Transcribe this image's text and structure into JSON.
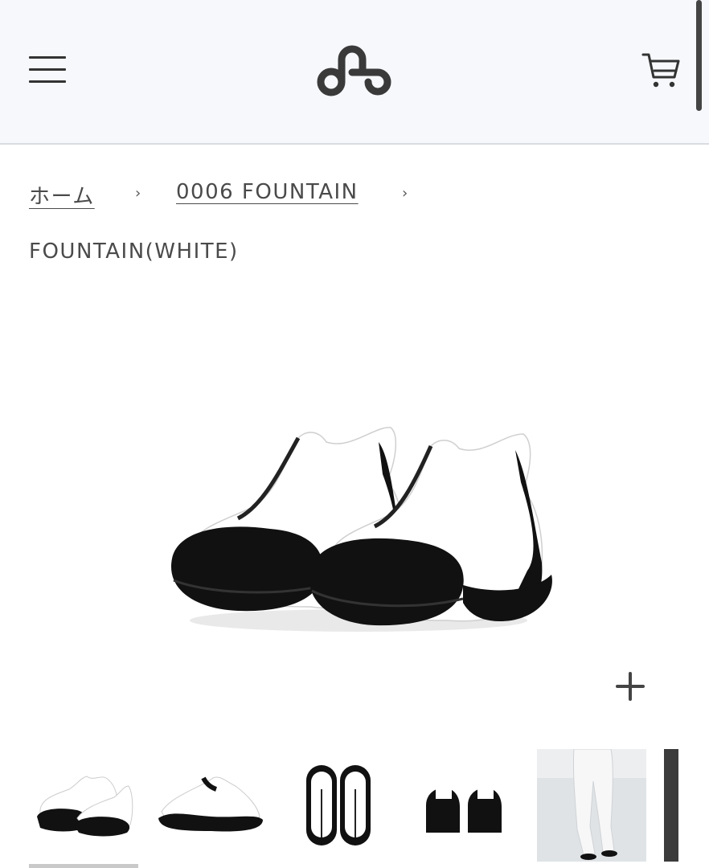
{
  "header": {
    "menu_icon": "hamburger-menu-icon",
    "logo_icon": "brand-logo",
    "cart_icon": "shopping-cart-icon"
  },
  "breadcrumb": {
    "home_label": "ホーム",
    "collection_label": "0006 FOUNTAIN",
    "separator": "›",
    "current": "FOUNTAIN(WHITE)"
  },
  "product": {
    "zoom_label": "+",
    "thumbnails": [
      {
        "name": "pair-front-angle"
      },
      {
        "name": "single-side-view"
      },
      {
        "name": "top-view-pair"
      },
      {
        "name": "back-view-pair"
      },
      {
        "name": "model-wearing"
      },
      {
        "name": "partial-next-thumbnail"
      }
    ]
  },
  "colors": {
    "header_bg": "#f6f8fc",
    "text": "#4a4a4a",
    "shoe_black": "#111111",
    "shoe_white": "#ffffff"
  }
}
